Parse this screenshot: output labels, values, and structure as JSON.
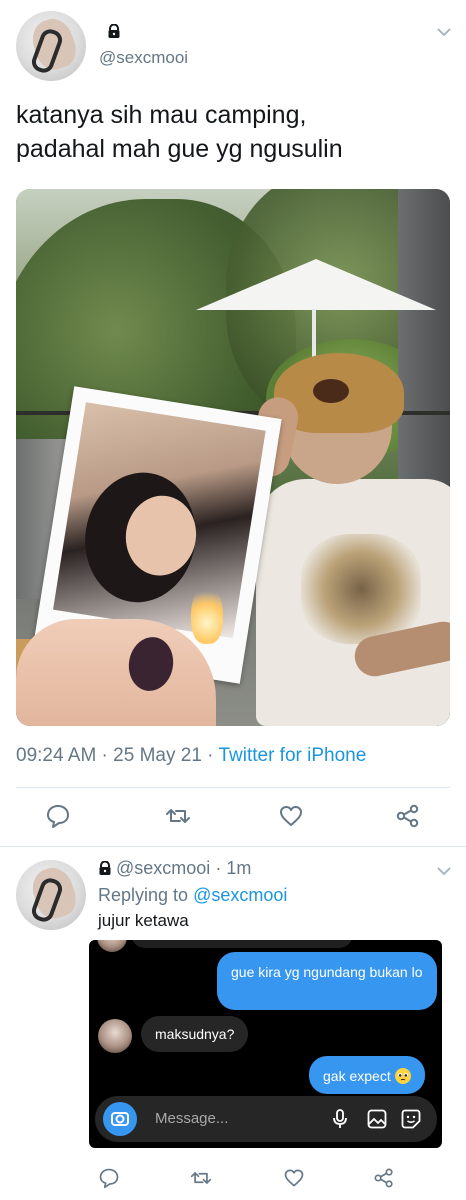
{
  "tweet": {
    "handle": "@sexcmooi",
    "text_line1": "katanya sih mau camping,",
    "text_line2": "padahal mah gue yg ngusulin",
    "time": "09:24 AM",
    "date": "25 May 21",
    "source": "Twitter for iPhone",
    "separator": " · "
  },
  "reply": {
    "handle": "@sexcmooi",
    "time": "1m",
    "replying_label": "Replying to",
    "replying_to": "@sexcmooi",
    "text": "jujur ketawa"
  },
  "chat": {
    "messages": [
      {
        "side": "right",
        "text": "gue kira yg ngundang bukan lo"
      },
      {
        "side": "left",
        "text": "maksudnya?"
      },
      {
        "side": "right",
        "text": "gak expect"
      }
    ],
    "message_placeholder": "Message..."
  },
  "icons": {
    "lock": "lock-icon",
    "chevron": "chevron-down-icon",
    "reply": "reply-icon",
    "retweet": "retweet-icon",
    "like": "heart-icon",
    "share": "share-icon",
    "camera": "camera-icon",
    "mic": "microphone-icon",
    "gallery": "image-icon",
    "sticker": "sticker-icon"
  },
  "colors": {
    "link_blue": "#1b95e0",
    "secondary_gray": "#657786",
    "chat_bg": "#000000",
    "chat_blue": "#3797f0",
    "chat_gray": "#262626"
  }
}
